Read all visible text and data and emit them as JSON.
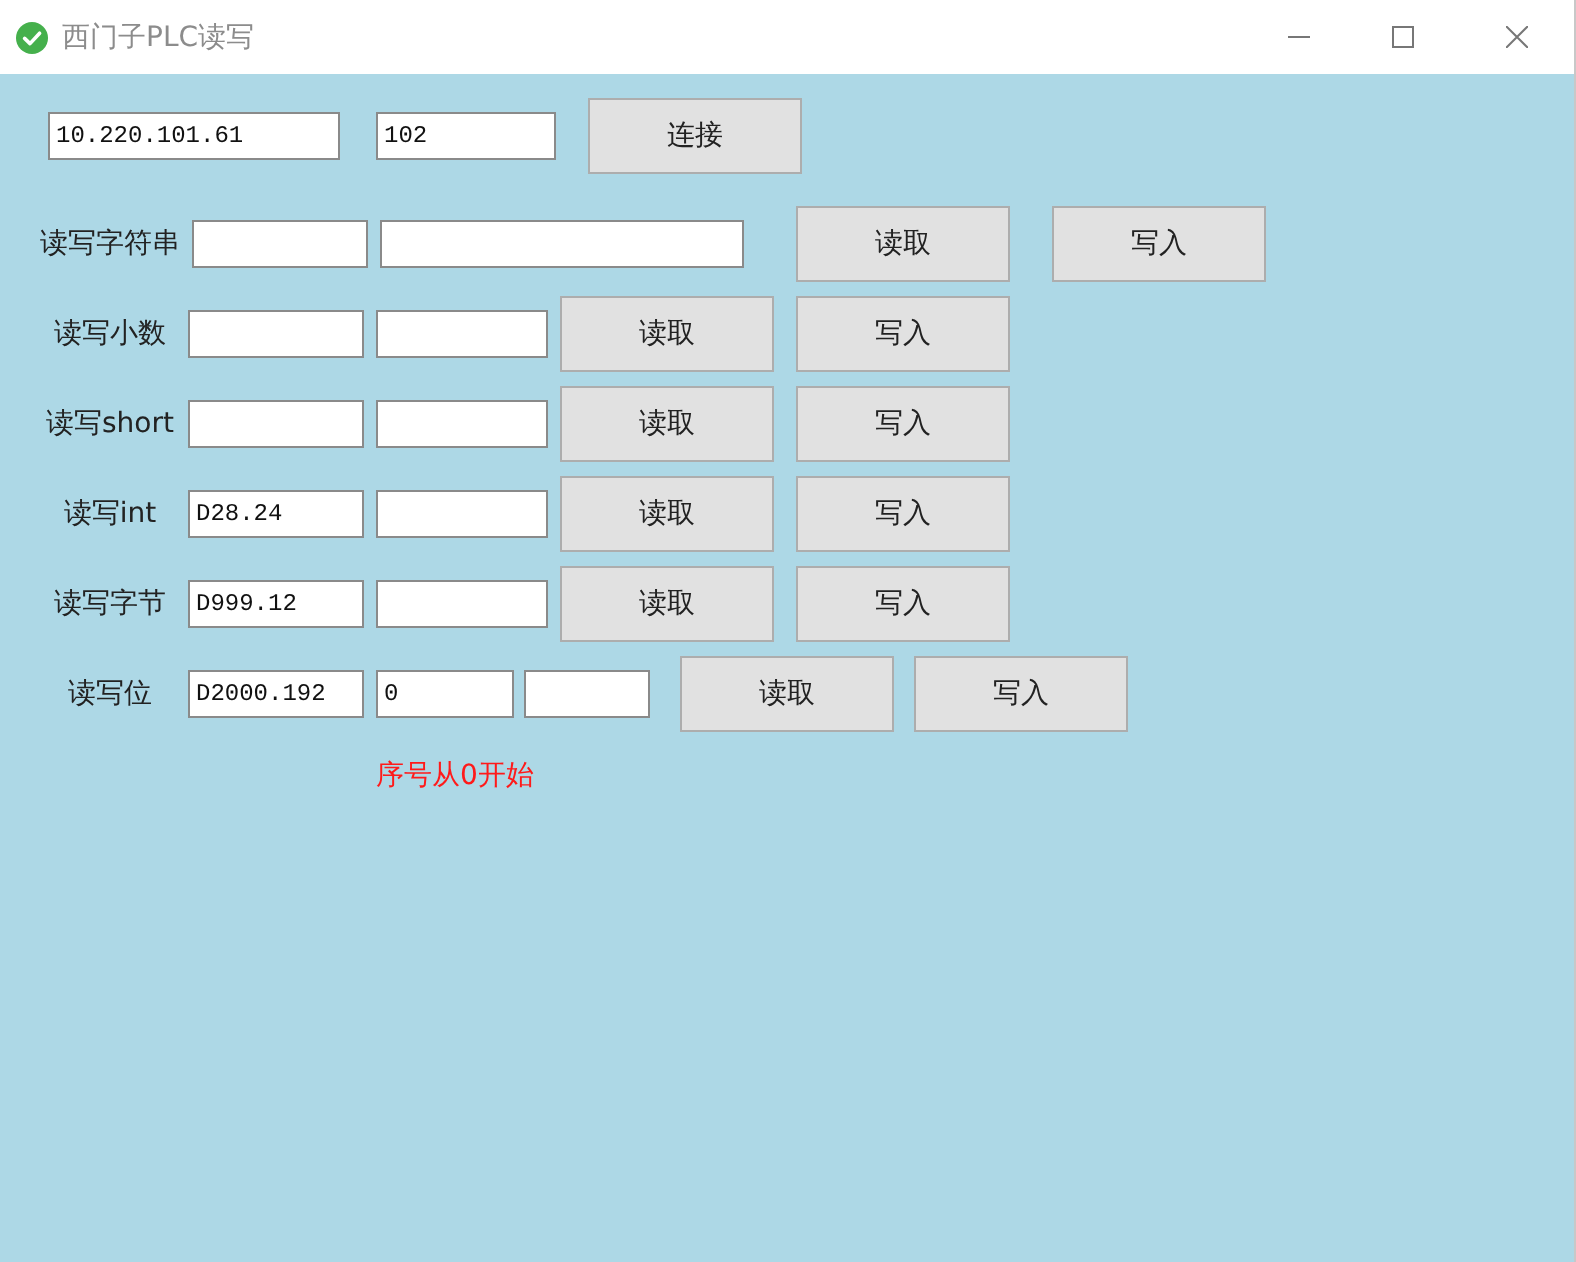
{
  "window": {
    "title": "西门子PLC读写"
  },
  "connection": {
    "ip": "10.220.101.61",
    "port": "102",
    "button": "连接"
  },
  "rows": [
    {
      "kind": "string",
      "label": "读写字符串",
      "read_button": "读取",
      "write_button": "写入"
    },
    {
      "kind": "number",
      "label": "读写小数",
      "read_button": "读取",
      "write_button": "写入"
    },
    {
      "kind": "number",
      "label": "读写short",
      "read_button": "读取",
      "write_button": "写入"
    },
    {
      "kind": "number",
      "label": "读写int",
      "address": "D28.24",
      "read_button": "读取",
      "write_button": "写入"
    },
    {
      "kind": "number",
      "label": "读写字节",
      "address": "D999.12",
      "read_button": "读取",
      "write_button": "写入"
    },
    {
      "kind": "bit",
      "label": "读写位",
      "address": "D2000.192",
      "index": "0",
      "read_button": "读取",
      "write_button": "写入"
    }
  ],
  "note": "序号从0开始"
}
